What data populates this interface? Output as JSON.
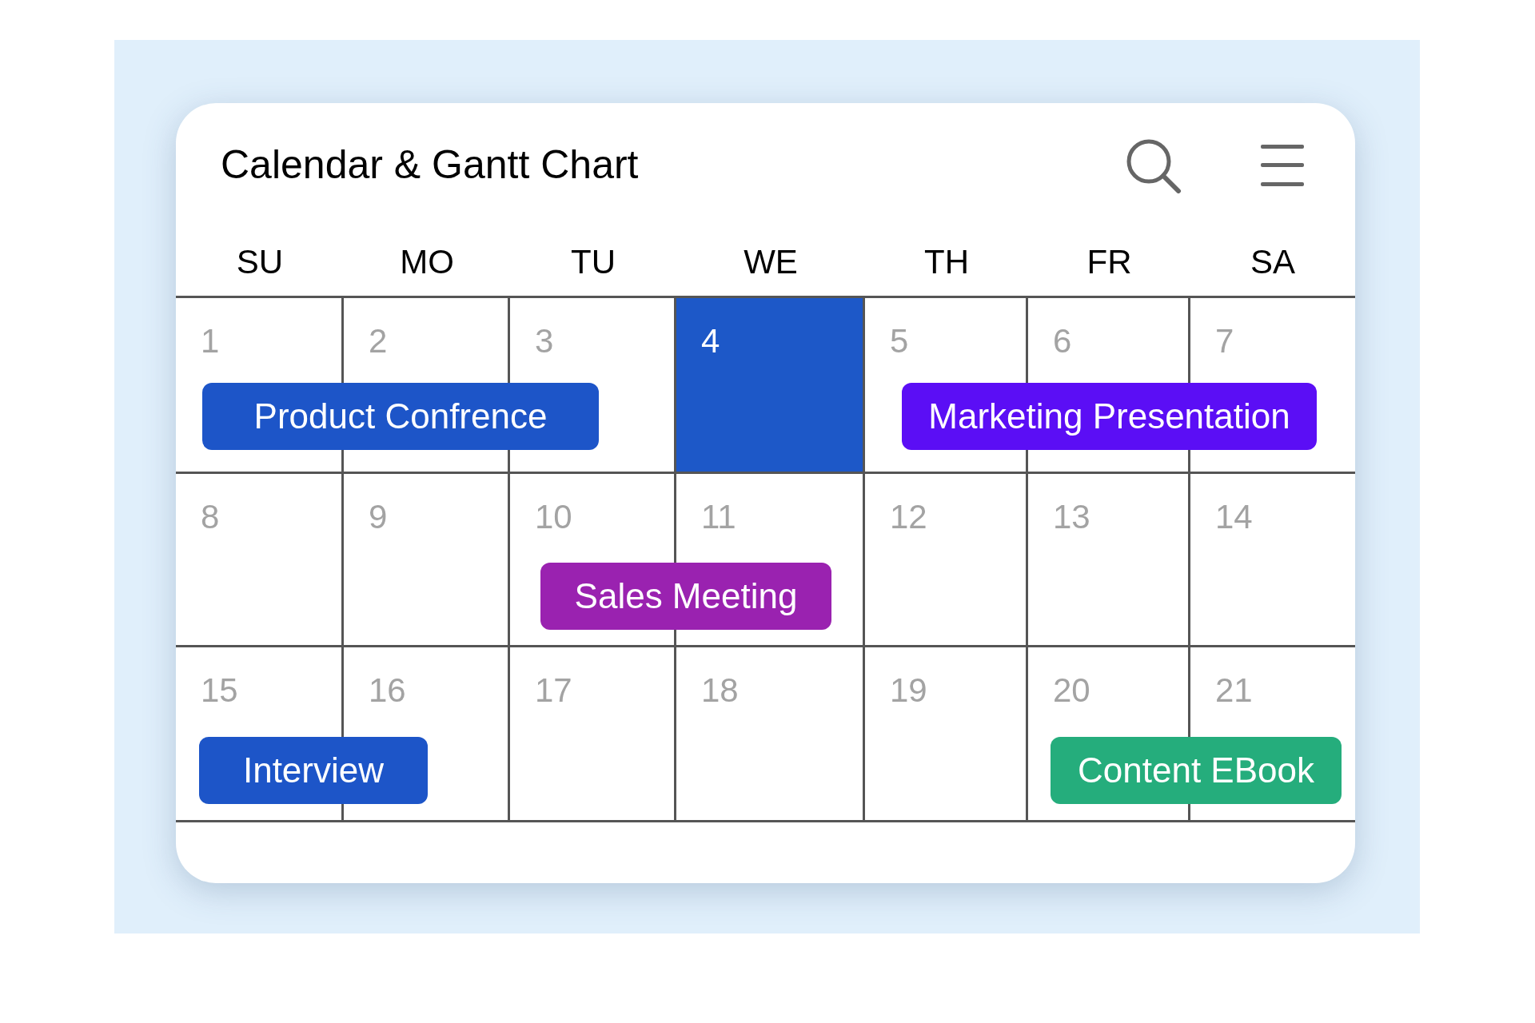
{
  "title": "Calendar & Gantt Chart",
  "weekdays": [
    "SU",
    "MO",
    "TU",
    "WE",
    "TH",
    "FR",
    "SA"
  ],
  "weeks": [
    {
      "days": [
        {
          "label": "1",
          "selected": false
        },
        {
          "label": "2",
          "selected": false
        },
        {
          "label": "3",
          "selected": false
        },
        {
          "label": "4",
          "selected": true
        },
        {
          "label": "5",
          "selected": false
        },
        {
          "label": "6",
          "selected": false
        },
        {
          "label": "7",
          "selected": false
        }
      ],
      "events": [
        {
          "label": "Product Confrence",
          "color": "#1d55c8"
        },
        {
          "label": "Marketing Presentation",
          "color": "#5b0ef5"
        }
      ]
    },
    {
      "days": [
        {
          "label": "8",
          "selected": false
        },
        {
          "label": "9",
          "selected": false
        },
        {
          "label": "10",
          "selected": false
        },
        {
          "label": "11",
          "selected": false
        },
        {
          "label": "12",
          "selected": false
        },
        {
          "label": "13",
          "selected": false
        },
        {
          "label": "14",
          "selected": false
        }
      ],
      "events": [
        {
          "label": "Sales Meeting",
          "color": "#9a22b0"
        }
      ]
    },
    {
      "days": [
        {
          "label": "15",
          "selected": false
        },
        {
          "label": "16",
          "selected": false
        },
        {
          "label": "17",
          "selected": false
        },
        {
          "label": "18",
          "selected": false
        },
        {
          "label": "19",
          "selected": false
        },
        {
          "label": "20",
          "selected": false
        },
        {
          "label": "21",
          "selected": false
        }
      ],
      "events": [
        {
          "label": "Interview",
          "color": "#1d55c8"
        },
        {
          "label": "Content EBook",
          "color": "#25ad7c"
        }
      ]
    }
  ]
}
